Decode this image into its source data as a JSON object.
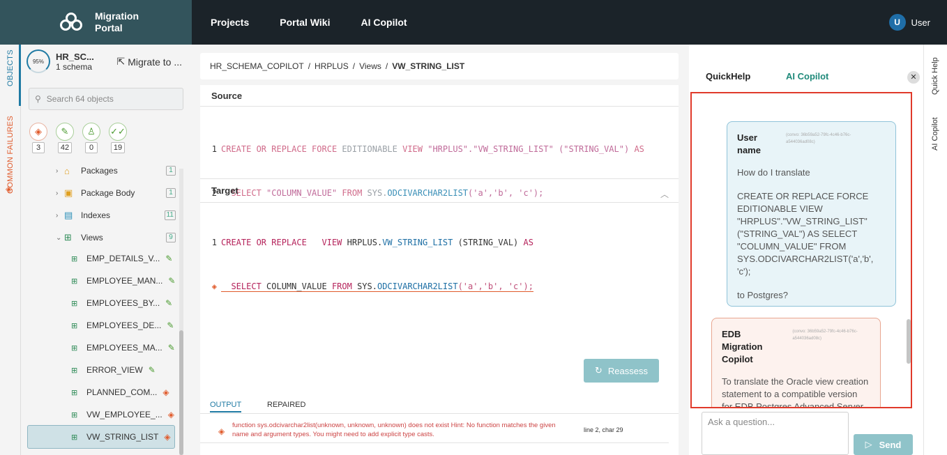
{
  "brand": {
    "line1": "Migration",
    "line2": "Portal"
  },
  "nav": [
    {
      "label": "Projects"
    },
    {
      "label": "Portal Wiki"
    },
    {
      "label": "AI Copilot"
    }
  ],
  "user": {
    "initial": "U",
    "name": "User"
  },
  "rail": {
    "objects": "OBJECTS",
    "failures": "COMMON FAILURES"
  },
  "project": {
    "progress": "95%",
    "progress_value": 0.95,
    "name": "HR_SC...",
    "schemas": "1 schema",
    "migrate_label": "Migrate to ..."
  },
  "search": {
    "placeholder": "Search 64 objects"
  },
  "stats": [
    {
      "icon": "error-diamond-icon",
      "count": "3"
    },
    {
      "icon": "wrench-icon",
      "count": "42"
    },
    {
      "icon": "user-icon",
      "count": "0"
    },
    {
      "icon": "double-check-icon",
      "count": "19"
    }
  ],
  "tree": {
    "groups": [
      {
        "label": "Packages",
        "count": "1"
      },
      {
        "label": "Package Body",
        "count": "1"
      },
      {
        "label": "Indexes",
        "count": "11"
      },
      {
        "label": "Views",
        "count": "9"
      }
    ],
    "views": [
      {
        "label": "EMP_DETAILS_V...",
        "status": "ok"
      },
      {
        "label": "EMPLOYEE_MAN...",
        "status": "ok"
      },
      {
        "label": "EMPLOYEES_BY...",
        "status": "ok"
      },
      {
        "label": "EMPLOYEES_DE...",
        "status": "ok"
      },
      {
        "label": "EMPLOYEES_MA...",
        "status": "ok"
      },
      {
        "label": "ERROR_VIEW",
        "status": "ok"
      },
      {
        "label": "PLANNED_COM...",
        "status": "error"
      },
      {
        "label": "VW_EMPLOYEE_...",
        "status": "error"
      },
      {
        "label": "VW_STRING_LIST",
        "status": "error"
      }
    ]
  },
  "breadcrumb": [
    "HR_SCHEMA_COPILOT",
    "HRPLUS",
    "Views",
    "VW_STRING_LIST"
  ],
  "source": {
    "title": "Source",
    "line1_no": "1",
    "line2_no": "2",
    "l1_a": "CREATE OR REPLACE FORCE",
    "l1_b": " EDITIONABLE ",
    "l1_c": "VIEW",
    "l1_d": " \"HRPLUS\".\"VW_STRING_LIST\" (\"STRING_VAL\") ",
    "l1_e": "AS",
    "l2_a": "  SELECT",
    "l2_b": " \"COLUMN_VALUE\" ",
    "l2_c": "FROM",
    "l2_d": " SYS.",
    "l2_e": "ODCIVARCHAR2LIST",
    "l2_f": "('a','b', 'c');"
  },
  "target": {
    "title": "Target",
    "line1_no": "1",
    "l1_a": "CREATE OR REPLACE",
    "l1_b": "   VIEW",
    "l1_c": " HRPLUS.",
    "l1_d": "VW_STRING_LIST",
    "l1_e": " (STRING_VAL) ",
    "l1_f": "AS",
    "l2_a": "  SELECT",
    "l2_b": " COLUMN_VALUE ",
    "l2_c": "FROM",
    "l2_d": " SYS.",
    "l2_e": "ODCIVARCHAR2LIST",
    "l2_f": "('a','b', 'c');"
  },
  "reassess_label": "Reassess",
  "output": {
    "tabs": [
      "OUTPUT",
      "REPAIRED"
    ],
    "message": "function sys.odcivarchar2list(unknown, unknown, unknown) does not exist Hint: No function matches the given name and argument types. You might need to add explicit type casts.",
    "location": "line 2, char 29"
  },
  "right_panel": {
    "tab_quickhelp": "QuickHelp",
    "tab_copilot": "AI Copilot",
    "user_bubble": {
      "name": "User name",
      "convo": "(convo: 36b59a52-79fc-4c46-b76c-a544036ad08c)",
      "p1": "How do I translate",
      "p2": "CREATE OR REPLACE FORCE EDITIONABLE VIEW \"HRPLUS\".\"VW_STRING_LIST\" (\"STRING_VAL\") AS SELECT \"COLUMN_VALUE\" FROM SYS.ODCIVARCHAR2LIST('a','b', 'c');",
      "p3": "to Postgres?"
    },
    "bot_bubble": {
      "name": "EDB Migration Copilot",
      "convo": "(convo: 36b59a52-79fc-4c46-b76c-a544036ad08c)",
      "p1": "To translate the Oracle view creation statement to a compatible version for EDB Postgres Advanced Server (EPAS), you can use the following"
    },
    "ask_placeholder": "Ask a question...",
    "send_label": "Send"
  },
  "right_rail": {
    "quick_help": "Quick Help",
    "ai_copilot": "AI Copilot"
  },
  "colors": {
    "accent": "#1f7aa3",
    "error": "#e05a2b",
    "ok": "#4a9a2f",
    "highlight_frame": "#e03a2a"
  }
}
